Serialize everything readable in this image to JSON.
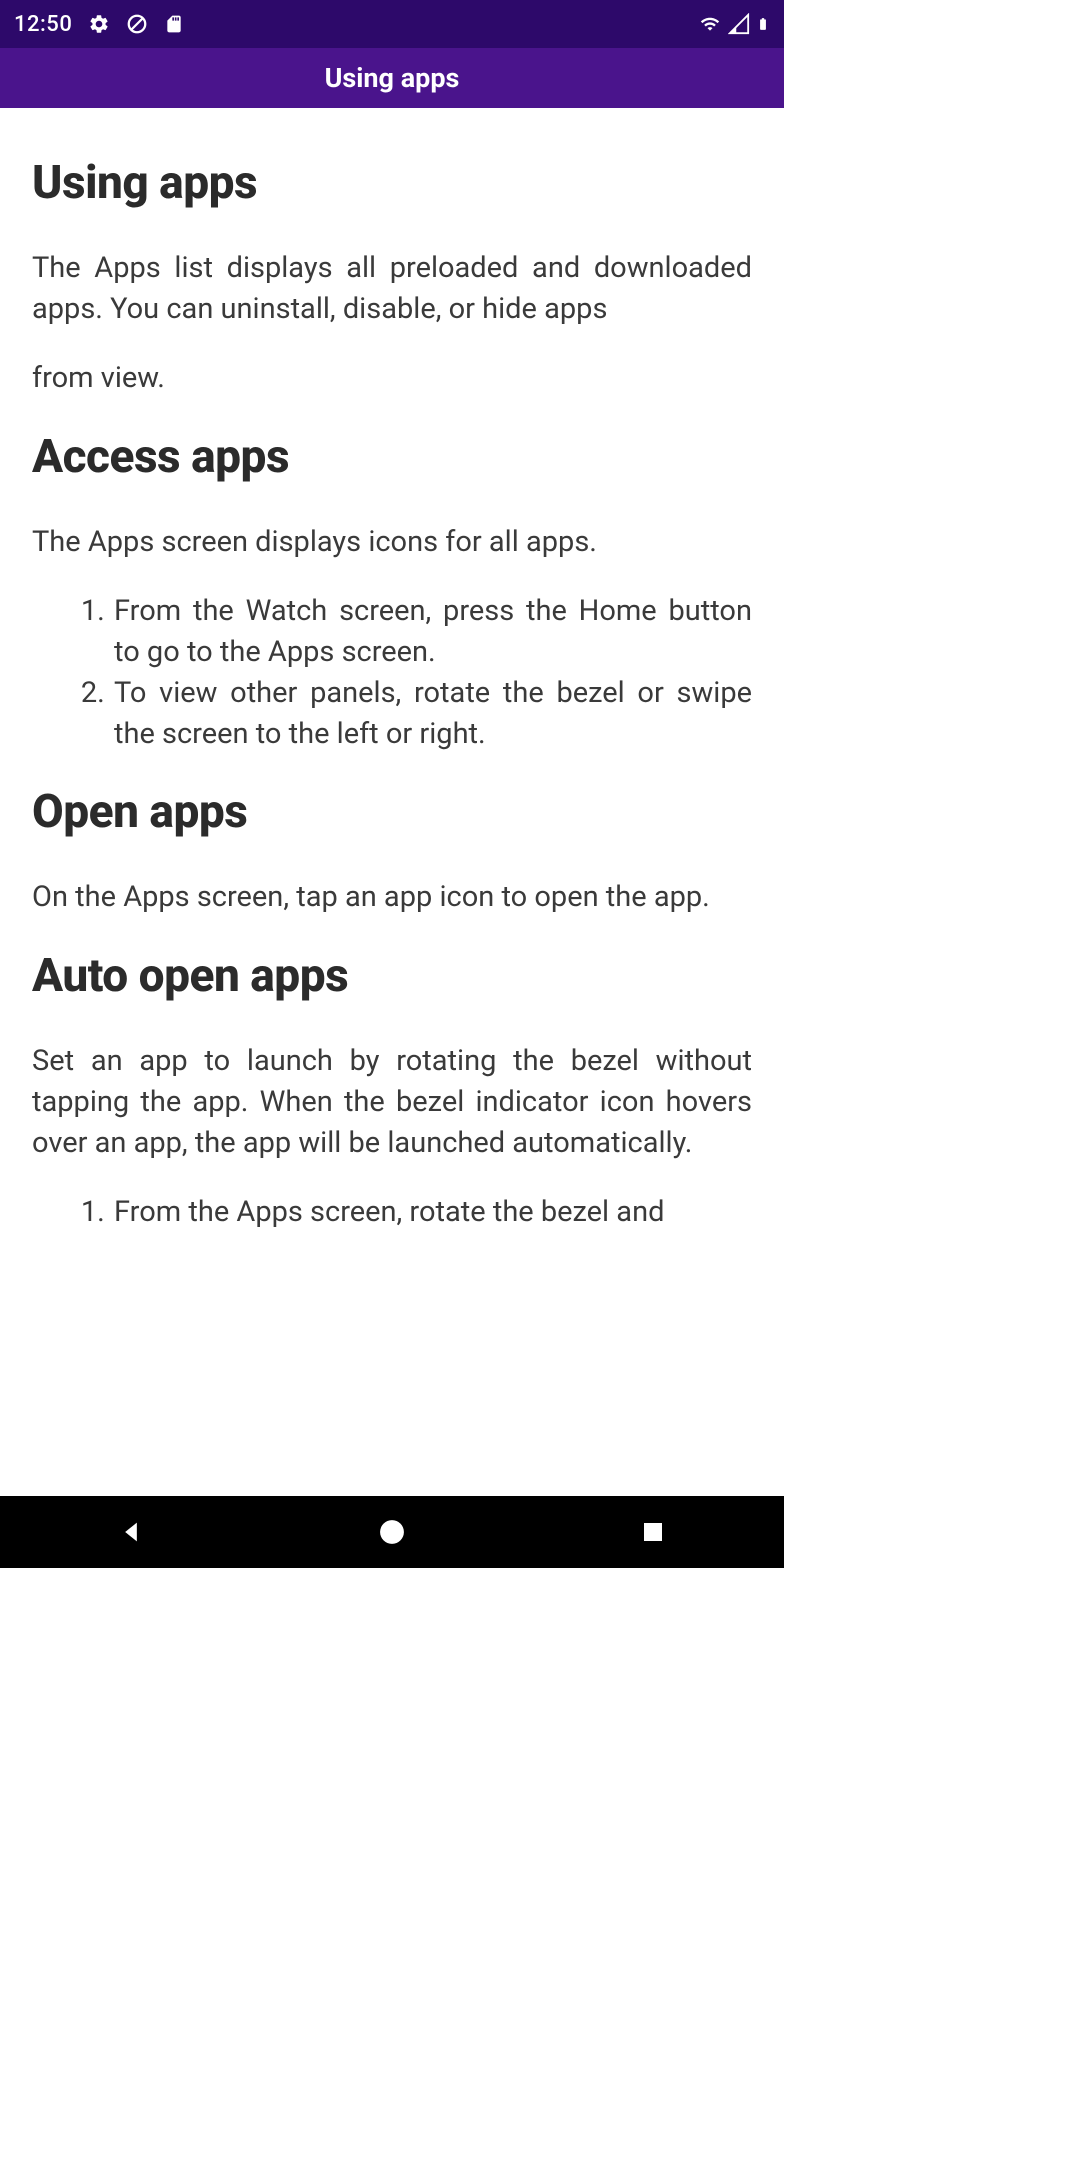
{
  "status": {
    "time": "12:50",
    "icons": {
      "settings": "gear-icon",
      "nosign": "circle-slash-icon",
      "storage": "sd-card-icon",
      "wifi": "wifi-icon",
      "signal": "signal-icon",
      "battery": "battery-icon"
    }
  },
  "appBar": {
    "title": "Using apps"
  },
  "content": {
    "h1_1": "Using apps",
    "p1": "The Apps list displays all preloaded and downloaded apps. You can uninstall, disable, or hide apps",
    "p2": "from view.",
    "h1_2": "Access apps",
    "p3": "The Apps screen displays icons for all apps.",
    "list1": {
      "item1": "From the Watch screen, press the Home button to go to the Apps screen.",
      "item2": "To view other panels, rotate the bezel or swipe the screen to the left or right."
    },
    "h1_3": "Open apps",
    "p4": "On the Apps screen, tap an app icon to open the app.",
    "h1_4": "Auto open apps",
    "p5": "Set an app to launch by rotating the bezel without tapping the app. When the bezel indicator icon hovers over an app, the app will be launched automatically.",
    "list2": {
      "item1": "From the Apps screen, rotate the bezel and"
    }
  },
  "nav": {
    "back": "back-button",
    "home": "home-button",
    "recent": "recent-button"
  },
  "colors": {
    "statusBar": "#2d096a",
    "appBar": "#4a148c",
    "text": "#333333",
    "navBar": "#000000"
  }
}
